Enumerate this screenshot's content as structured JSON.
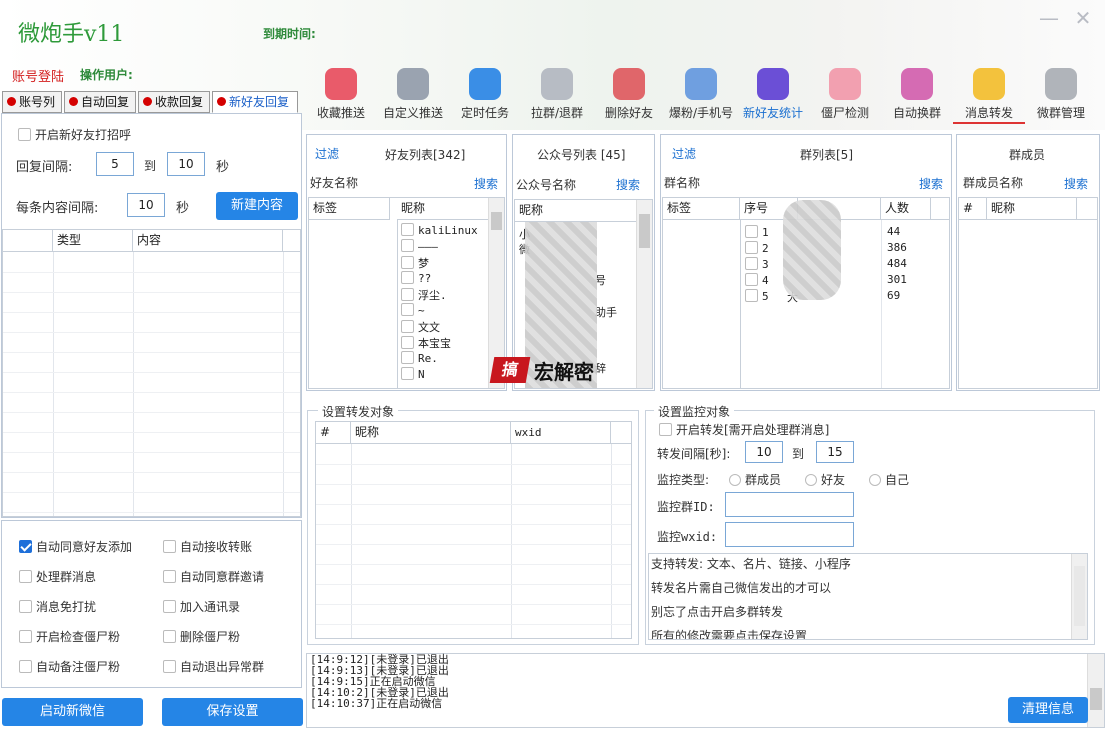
{
  "app": {
    "title": "微炮手v11",
    "expire_label": "到期时间:",
    "login_label": "账号登陆",
    "operator_label": "操作用户:",
    "minimize": "—",
    "close": "✕"
  },
  "toolbar": [
    {
      "label": "收藏推送",
      "icon": "favorite-icon",
      "color": "#e95b6a"
    },
    {
      "label": "自定义推送",
      "icon": "paper-plane-icon",
      "color": "#9aa3b0"
    },
    {
      "label": "定时任务",
      "icon": "contact-card-icon",
      "color": "#3a8ee6"
    },
    {
      "label": "拉群/退群",
      "icon": "users-icon",
      "color": "#b7bcc4"
    },
    {
      "label": "删除好友",
      "icon": "remove-user-icon",
      "color": "#e0666a"
    },
    {
      "label": "爆粉/手机号",
      "icon": "user-info-icon",
      "color": "#6f9fe0"
    },
    {
      "label": "新好友统计",
      "icon": "new-user-icon",
      "color": "#6b4fd6"
    },
    {
      "label": "僵尸检测",
      "icon": "zombie-face-icon",
      "color": "#f2a0b0"
    },
    {
      "label": "自动换群",
      "icon": "switch-group-icon",
      "color": "#d56bb3"
    },
    {
      "label": "消息转发",
      "icon": "message-forward-icon",
      "color": "#f3c23d"
    },
    {
      "label": "微群管理",
      "icon": "gear-icon",
      "color": "#b0b4ba"
    }
  ],
  "tabs": [
    "账号列",
    "自动回复",
    "收款回复",
    "新好友回复"
  ],
  "greeting": {
    "enable_label": "开启新好友打招呼",
    "interval_label": "回复间隔:",
    "from": "5",
    "to_label": "到",
    "to": "10",
    "unit": "秒",
    "content_interval_label": "每条内容间隔:",
    "content_interval": "10",
    "content_unit": "秒",
    "new_button": "新建内容",
    "col_type": "类型",
    "col_content": "内容"
  },
  "options": [
    {
      "label": "自动同意好友添加",
      "checked": true
    },
    {
      "label": "自动接收转账",
      "checked": false
    },
    {
      "label": "处理群消息",
      "checked": false
    },
    {
      "label": "自动同意群邀请",
      "checked": false
    },
    {
      "label": "消息免打扰",
      "checked": false
    },
    {
      "label": "加入通讯录",
      "checked": false
    },
    {
      "label": "开启检查僵尸粉",
      "checked": false
    },
    {
      "label": "删除僵尸粉",
      "checked": false
    },
    {
      "label": "自动备注僵尸粉",
      "checked": false
    },
    {
      "label": "自动退出异常群",
      "checked": false
    }
  ],
  "bottom_buttons": {
    "start": "启动新微信",
    "save": "保存设置"
  },
  "friends": {
    "filter": "过滤",
    "title": "好友列表[342]",
    "name_label": "好友名称",
    "search": "搜索",
    "col_tag": "标签",
    "col_nick": "昵称",
    "items": [
      "kaliLinux",
      "———",
      "梦",
      "??",
      "浮尘.",
      "~",
      "文文",
      "本宝宝",
      "Re.",
      "N"
    ]
  },
  "official": {
    "title": "公众号列表 [45]",
    "name_label": "公众号名称",
    "search": "搜索",
    "col_nick": "昵称",
    "items": [
      "小",
      "微",
      "号",
      "助手",
      "辞"
    ]
  },
  "groups": {
    "filter": "过滤",
    "title": "群列表[5]",
    "name_label": "群名称",
    "search": "搜索",
    "col_tag": "标签",
    "col_no": "序号",
    "col_count": "人数",
    "rows": [
      {
        "no": "1",
        "count": "44"
      },
      {
        "no": "2",
        "count": "386"
      },
      {
        "no": "3",
        "count": "484"
      },
      {
        "no": "4",
        "count": "301"
      },
      {
        "no": "5",
        "count": "69"
      }
    ],
    "row5_name": "大"
  },
  "members": {
    "title": "群成员",
    "name_label": "群成员名称",
    "search": "搜索",
    "col_hash": "#",
    "col_nick": "昵称"
  },
  "forward": {
    "title": "设置转发对象",
    "col_hash": "#",
    "col_nick": "昵称",
    "col_wxid": "wxid"
  },
  "monitor": {
    "title": "设置监控对象",
    "enable_label": "开启转发[需开启处理群消息]",
    "interval_label": "转发间隔[秒]:",
    "from": "10",
    "to_label": "到",
    "to": "15",
    "type_label": "监控类型:",
    "types": [
      "群成员",
      "好友",
      "自己"
    ],
    "group_id_label": "监控群ID:",
    "wxid_label": "监控wxid:",
    "tips": [
      "支持转发: 文本、名片、链接、小程序",
      "转发名片需自己微信发出的才可以",
      "别忘了点击开启多群转发",
      "所有的修改需要点击保存设置"
    ]
  },
  "log": {
    "lines": [
      "[14:9:12][未登录]已退出",
      "[14:9:13][未登录]已退出",
      "[14:9:15]正在启动微信",
      "[14:10:2][未登录]已退出",
      "[14:10:37]正在启动微信"
    ],
    "clear_button": "清理信息"
  },
  "watermark": "宏解密"
}
